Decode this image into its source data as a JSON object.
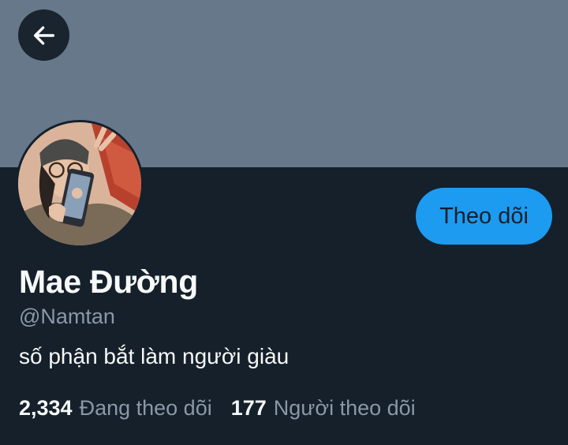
{
  "header": {
    "back_icon": "arrow-left-icon"
  },
  "profile": {
    "display_name": "Mae Đường",
    "handle": "@Namtan",
    "bio": "số phận bắt làm người giàu",
    "follow_label": "Theo dõi",
    "following_count": "2,334",
    "following_label": "Đang theo dõi",
    "followers_count": "177",
    "followers_label": "Người theo dõi"
  },
  "colors": {
    "banner": "#66788a",
    "background": "#15202b",
    "accent": "#1d9bf0",
    "text_primary": "#f7f9f9",
    "text_secondary": "#8b98a5"
  }
}
